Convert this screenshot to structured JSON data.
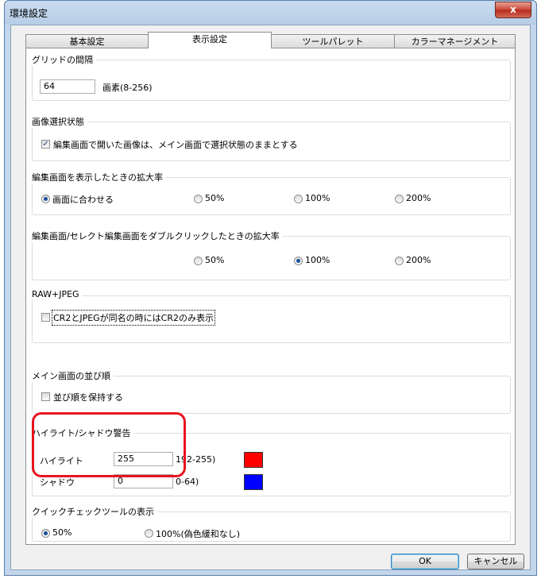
{
  "window": {
    "title": "環境設定",
    "close_label": "x"
  },
  "tabs": [
    {
      "label": "基本設定"
    },
    {
      "label": "表示設定"
    },
    {
      "label": "ツールパレット"
    },
    {
      "label": "カラーマネージメント"
    }
  ],
  "grid": {
    "title": "グリッドの間隔",
    "value": "64",
    "unit": "画素(8-256)"
  },
  "selection": {
    "title": "画像選択状態",
    "checkbox_label": "編集画面で開いた画像は、メイン画面で選択状態のままとする",
    "checked": true
  },
  "edit_zoom": {
    "title": "編集画面を表示したときの拡大率",
    "options": [
      "画面に合わせる",
      "50%",
      "100%",
      "200%"
    ],
    "selected": "画面に合わせる"
  },
  "dblclick_zoom": {
    "title": "編集画面/セレクト編集画面をダブルクリックしたときの拡大率",
    "options": [
      "50%",
      "100%",
      "200%"
    ],
    "selected": "100%"
  },
  "raw": {
    "title": "RAW+JPEG",
    "checkbox_label": "CR2とJPEGが同名の時にはCR2のみ表示",
    "checked": false
  },
  "sort": {
    "title": "メイン画面の並び順",
    "checkbox_label": "並び順を保持する",
    "checked": false
  },
  "warning": {
    "title": "ハイライト/シャドウ警告",
    "highlight_label": "ハイライト",
    "highlight_value": "255",
    "highlight_range": "192-255)",
    "highlight_color": "#ff0000",
    "shadow_label": "シャドウ",
    "shadow_value": "0",
    "shadow_range": "0-64)",
    "shadow_color": "#0000ff"
  },
  "quickcheck": {
    "title": "クイックチェックツールの表示",
    "options": [
      "50%",
      "100%(偽色緩和なし)"
    ],
    "selected": "50%"
  },
  "buttons": {
    "ok": "OK",
    "cancel": "キャンセル"
  }
}
